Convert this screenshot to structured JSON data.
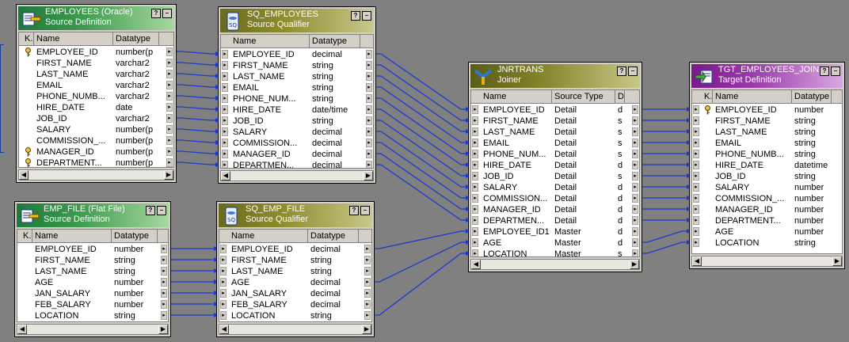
{
  "colors": {
    "link": "#1a3ad0",
    "canvas": "#808080"
  },
  "transformations": [
    {
      "id": "emp_src",
      "title": "EMPLOYEES (Oracle)",
      "subtitle": "Source Definition",
      "icon": "source-definition-icon",
      "style": "src",
      "columns": [
        "K.",
        "Name",
        "Datatype"
      ],
      "rows": [
        {
          "key": true,
          "name": "EMPLOYEE_ID",
          "type": "number(p"
        },
        {
          "key": false,
          "name": "FIRST_NAME",
          "type": "varchar2"
        },
        {
          "key": false,
          "name": "LAST_NAME",
          "type": "varchar2"
        },
        {
          "key": false,
          "name": "EMAIL",
          "type": "varchar2"
        },
        {
          "key": false,
          "name": "PHONE_NUMB...",
          "type": "varchar2"
        },
        {
          "key": false,
          "name": "HIRE_DATE",
          "type": "date"
        },
        {
          "key": false,
          "name": "JOB_ID",
          "type": "varchar2"
        },
        {
          "key": false,
          "name": "SALARY",
          "type": "number(p"
        },
        {
          "key": false,
          "name": "COMMISSION_...",
          "type": "number(p"
        },
        {
          "key": true,
          "name": "MANAGER_ID",
          "type": "number(p"
        },
        {
          "key": true,
          "name": "DEPARTMENT...",
          "type": "number(p"
        }
      ]
    },
    {
      "id": "sq_emp",
      "title": "SQ_EMPLOYEES",
      "subtitle": "Source Qualifier",
      "icon": "source-qualifier-icon",
      "style": "sq",
      "columns": [
        "Name",
        "Datatype"
      ],
      "rows": [
        {
          "name": "EMPLOYEE_ID",
          "type": "decimal"
        },
        {
          "name": "FIRST_NAME",
          "type": "string"
        },
        {
          "name": "LAST_NAME",
          "type": "string"
        },
        {
          "name": "EMAIL",
          "type": "string"
        },
        {
          "name": "PHONE_NUM...",
          "type": "string"
        },
        {
          "name": "HIRE_DATE",
          "type": "date/time"
        },
        {
          "name": "JOB_ID",
          "type": "string"
        },
        {
          "name": "SALARY",
          "type": "decimal"
        },
        {
          "name": "COMMISSION...",
          "type": "decimal"
        },
        {
          "name": "MANAGER_ID",
          "type": "decimal"
        },
        {
          "name": "DEPARTMEN...",
          "type": "decimal"
        }
      ]
    },
    {
      "id": "file_src",
      "title": "EMP_FILE (Flat File)",
      "subtitle": "Source Definition",
      "icon": "flat-file-source-icon",
      "style": "src",
      "columns": [
        "K.",
        "Name",
        "Datatype"
      ],
      "rows": [
        {
          "key": false,
          "name": "EMPLOYEE_ID",
          "type": "number"
        },
        {
          "key": false,
          "name": "FIRST_NAME",
          "type": "string"
        },
        {
          "key": false,
          "name": "LAST_NAME",
          "type": "string"
        },
        {
          "key": false,
          "name": "AGE",
          "type": "number"
        },
        {
          "key": false,
          "name": "JAN_SALARY",
          "type": "number"
        },
        {
          "key": false,
          "name": "FEB_SALARY",
          "type": "number"
        },
        {
          "key": false,
          "name": "LOCATION",
          "type": "string"
        }
      ]
    },
    {
      "id": "sq_file",
      "title": "SQ_EMP_FILE",
      "subtitle": "Source Qualifier",
      "icon": "source-qualifier-icon",
      "style": "sq",
      "columns": [
        "Name",
        "Datatype"
      ],
      "rows": [
        {
          "name": "EMPLOYEE_ID",
          "type": "decimal"
        },
        {
          "name": "FIRST_NAME",
          "type": "string"
        },
        {
          "name": "LAST_NAME",
          "type": "string"
        },
        {
          "name": "AGE",
          "type": "decimal"
        },
        {
          "name": "JAN_SALARY",
          "type": "decimal"
        },
        {
          "name": "FEB_SALARY",
          "type": "decimal"
        },
        {
          "name": "LOCATION",
          "type": "string"
        }
      ]
    },
    {
      "id": "joiner",
      "title": "JNRTRANS",
      "subtitle": "Joiner",
      "icon": "joiner-icon",
      "style": "jnr",
      "columns": [
        "Name",
        "Source Type",
        "D"
      ],
      "rows": [
        {
          "name": "EMPLOYEE_ID",
          "src": "Detail",
          "d": "d"
        },
        {
          "name": "FIRST_NAME",
          "src": "Detail",
          "d": "s"
        },
        {
          "name": "LAST_NAME",
          "src": "Detail",
          "d": "s"
        },
        {
          "name": "EMAIL",
          "src": "Detail",
          "d": "s"
        },
        {
          "name": "PHONE_NUM...",
          "src": "Detail",
          "d": "s"
        },
        {
          "name": "HIRE_DATE",
          "src": "Detail",
          "d": "d"
        },
        {
          "name": "JOB_ID",
          "src": "Detail",
          "d": "s"
        },
        {
          "name": "SALARY",
          "src": "Detail",
          "d": "d"
        },
        {
          "name": "COMMISSION...",
          "src": "Detail",
          "d": "d"
        },
        {
          "name": "MANAGER_ID",
          "src": "Detail",
          "d": "d"
        },
        {
          "name": "DEPARTMEN...",
          "src": "Detail",
          "d": "d"
        },
        {
          "name": "EMPLOYEE_ID1",
          "src": "Master",
          "d": "d"
        },
        {
          "name": "AGE",
          "src": "Master",
          "d": "d"
        },
        {
          "name": "LOCATION",
          "src": "Master",
          "d": "s"
        }
      ]
    },
    {
      "id": "target",
      "title": "TGT_EMPLOYEES_JOIN...",
      "subtitle": "Target Definition",
      "icon": "target-definition-icon",
      "style": "tgt",
      "columns": [
        "K.",
        "Name",
        "Datatype"
      ],
      "rows": [
        {
          "key": true,
          "name": "EMPLOYEE_ID",
          "type": "number"
        },
        {
          "key": false,
          "name": "FIRST_NAME",
          "type": "string"
        },
        {
          "key": false,
          "name": "LAST_NAME",
          "type": "string"
        },
        {
          "key": false,
          "name": "EMAIL",
          "type": "string"
        },
        {
          "key": false,
          "name": "PHONE_NUMB...",
          "type": "string"
        },
        {
          "key": false,
          "name": "HIRE_DATE",
          "type": "datetime"
        },
        {
          "key": false,
          "name": "JOB_ID",
          "type": "string"
        },
        {
          "key": false,
          "name": "SALARY",
          "type": "number"
        },
        {
          "key": false,
          "name": "COMMISSION_...",
          "type": "number"
        },
        {
          "key": false,
          "name": "MANAGER_ID",
          "type": "number"
        },
        {
          "key": false,
          "name": "DEPARTMENT...",
          "type": "number"
        },
        {
          "key": false,
          "name": "AGE",
          "type": "number"
        },
        {
          "key": false,
          "name": "LOCATION",
          "type": "string"
        }
      ]
    }
  ],
  "links": [
    {
      "from": "emp_src",
      "to": "sq_emp",
      "pairs": [
        [
          0,
          0
        ],
        [
          1,
          1
        ],
        [
          2,
          2
        ],
        [
          3,
          3
        ],
        [
          4,
          4
        ],
        [
          5,
          5
        ],
        [
          6,
          6
        ],
        [
          7,
          7
        ],
        [
          8,
          8
        ],
        [
          9,
          9
        ],
        [
          10,
          10
        ]
      ]
    },
    {
      "from": "file_src",
      "to": "sq_file",
      "pairs": [
        [
          0,
          0
        ],
        [
          1,
          1
        ],
        [
          2,
          2
        ],
        [
          3,
          3
        ],
        [
          4,
          4
        ],
        [
          5,
          5
        ],
        [
          6,
          6
        ]
      ]
    },
    {
      "from": "sq_emp",
      "to": "joiner",
      "pairs": [
        [
          0,
          0
        ],
        [
          1,
          1
        ],
        [
          2,
          2
        ],
        [
          3,
          3
        ],
        [
          4,
          4
        ],
        [
          5,
          5
        ],
        [
          6,
          6
        ],
        [
          7,
          7
        ],
        [
          8,
          8
        ],
        [
          9,
          9
        ],
        [
          10,
          10
        ]
      ]
    },
    {
      "from": "sq_file",
      "to": "joiner",
      "pairs": [
        [
          0,
          11
        ],
        [
          3,
          12
        ],
        [
          6,
          13
        ]
      ]
    },
    {
      "from": "joiner",
      "to": "target",
      "pairs": [
        [
          0,
          0
        ],
        [
          1,
          1
        ],
        [
          2,
          2
        ],
        [
          3,
          3
        ],
        [
          4,
          4
        ],
        [
          5,
          5
        ],
        [
          6,
          6
        ],
        [
          7,
          7
        ],
        [
          8,
          8
        ],
        [
          9,
          9
        ],
        [
          10,
          10
        ],
        [
          12,
          11
        ],
        [
          13,
          12
        ]
      ]
    }
  ]
}
